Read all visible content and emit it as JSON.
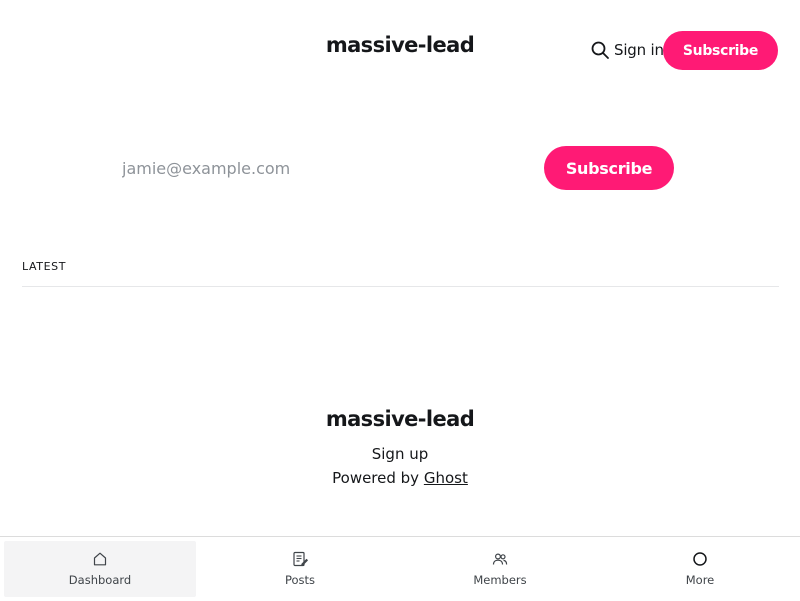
{
  "header": {
    "site_title": "massive-lead",
    "search_icon": "search-icon",
    "signin_label": "Sign in",
    "subscribe_label": "Subscribe"
  },
  "subscribe_form": {
    "email_placeholder": "jamie@example.com",
    "button_label": "Subscribe"
  },
  "feed": {
    "section_label": "LATEST"
  },
  "footer": {
    "site_title": "massive-lead",
    "signup_label": "Sign up",
    "powered_prefix": "Powered by",
    "powered_link": "Ghost"
  },
  "bottom_nav": {
    "items": [
      {
        "label": "Dashboard",
        "icon": "home-icon",
        "active": true
      },
      {
        "label": "Posts",
        "icon": "posts-icon",
        "active": false
      },
      {
        "label": "Members",
        "icon": "members-icon",
        "active": false
      },
      {
        "label": "More",
        "icon": "more-circle-icon",
        "active": false
      }
    ]
  },
  "colors": {
    "accent": "#ff1a75",
    "text": "#15171a",
    "muted": "#8e9399",
    "divider": "#e6e7e9"
  }
}
